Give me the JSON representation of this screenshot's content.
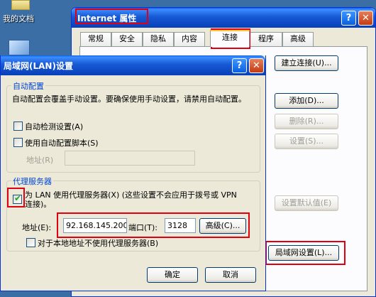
{
  "desktop": {
    "icon_label": "我的文档"
  },
  "internet_options": {
    "title": "Internet 属性",
    "tabs": [
      "常规",
      "安全",
      "隐私",
      "内容",
      "连接",
      "程序",
      "高级"
    ],
    "active_tab": "连接",
    "buttons": {
      "setup": "建立连接(U)...",
      "add": "添加(D)...",
      "remove": "删除(R)...",
      "settings": "设置(S)...",
      "set_default": "设置默认值(E)",
      "lan": "局域网设置(L)..."
    }
  },
  "lan_dialog": {
    "title": "局域网(LAN)设置",
    "auto_config": {
      "title": "自动配置",
      "description": "自动配置会覆盖手动设置。要确保使用手动设置，请禁用自动配置。",
      "auto_detect_label": "自动检测设置(A)",
      "auto_script_label": "使用自动配置脚本(S)",
      "address_label": "地址(R)",
      "address_value": ""
    },
    "proxy": {
      "title": "代理服务器",
      "use_proxy_label": "为 LAN 使用代理服务器(X) (这些设置不会应用于拨号或 VPN 连接)。",
      "use_proxy_checked": true,
      "address_label": "地址(E):",
      "address_value": "92.168.145.200",
      "port_label": "端口(T):",
      "port_value": "3128",
      "advanced_label": "高级(C)...",
      "bypass_label": "对于本地地址不使用代理服务器(B)"
    },
    "ok_label": "确定",
    "cancel_label": "取消"
  }
}
